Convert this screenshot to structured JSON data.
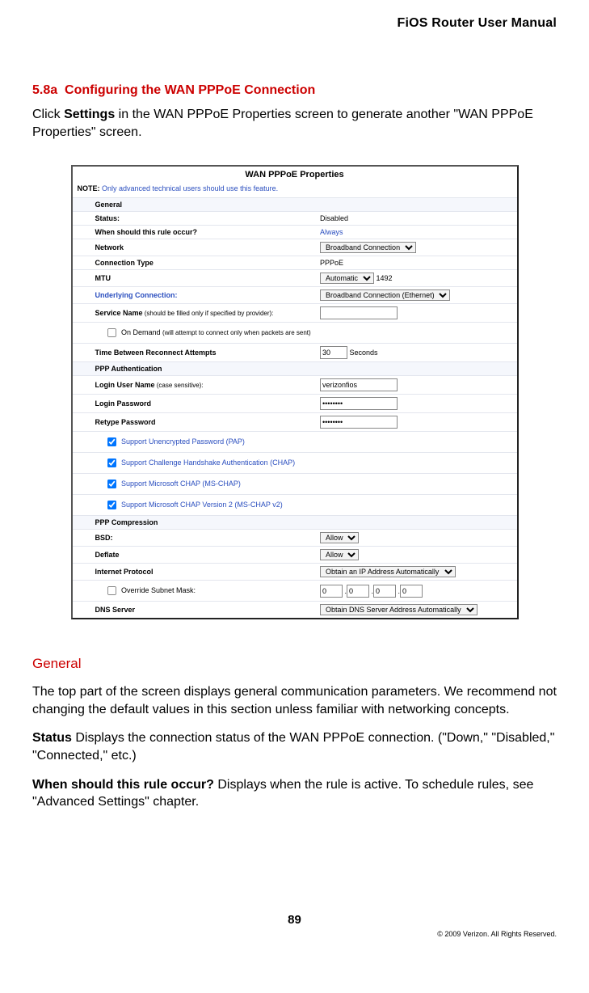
{
  "header": {
    "title": "FiOS Router User Manual"
  },
  "section": {
    "number": "5.8a",
    "title": "Configuring the WAN PPPoE Connection",
    "intro_prefix": "Click ",
    "intro_bold": "Settings",
    "intro_suffix": " in the WAN PPPoE Properties screen to generate another \"WAN PPPoE Properties\" screen."
  },
  "screenshot": {
    "title": "WAN PPPoE Properties",
    "note_label": "NOTE:",
    "note_text": " Only advanced technical users should use this feature.",
    "rows": {
      "general": "General",
      "status_l": "Status:",
      "status_v": "Disabled",
      "rule_l": "When should this rule occur?",
      "rule_v": "Always",
      "network_l": "Network",
      "network_v": "Broadband Connection",
      "conntype_l": "Connection Type",
      "conntype_v": "PPPoE",
      "mtu_l": "MTU",
      "mtu_sel": "Automatic",
      "mtu_num": "1492",
      "under_l": "Underlying Connection:",
      "under_v": "Broadband Connection (Ethernet)",
      "svcname_l": "Service Name",
      "svcname_sub": " (should be filled only if specified by provider):",
      "ondemand_l": " On Demand ",
      "ondemand_sub": "(will attempt to connect only when packets are sent)",
      "tbra_l": "Time Between Reconnect Attempts",
      "tbra_v": "30",
      "tbra_unit": "Seconds",
      "pppauth": "PPP Authentication",
      "login_l": "Login User Name",
      "login_sub": " (case sensitive):",
      "login_v": "verizonfios",
      "pwd_l": "Login Password",
      "pwd_v": "********",
      "rpwd_l": "Retype Password",
      "rpwd_v": "********",
      "pap": " Support Unencrypted Password (PAP)",
      "chap": " Support Challenge Handshake Authentication (CHAP)",
      "mschap": " Support Microsoft CHAP (MS-CHAP)",
      "mschap2": " Support Microsoft CHAP Version 2 (MS-CHAP v2)",
      "pppcomp": "PPP Compression",
      "bsd_l": "BSD:",
      "bsd_v": "Allow",
      "deflate_l": "Deflate",
      "deflate_v": "Allow",
      "ip_l": "Internet Protocol",
      "ip_v": "Obtain an IP Address Automatically",
      "subnet_l": " Override Subnet Mask:",
      "subnet_oct": "0",
      "dns_l": "DNS Server",
      "dns_v": "Obtain DNS Server Address Automatically"
    }
  },
  "general": {
    "heading": "General",
    "p1": "The top part of the screen displays general communication parameters. We recommend not changing the default values in this section unless familiar with networking concepts.",
    "status_label": "Status",
    "status_text": "  Displays the connection status of the WAN PPPoE connection. (\"Down,\" \"Disabled,\" \"Connected,\" etc.)",
    "rule_label": "When should this rule occur?",
    "rule_text": "  Displays when the rule is active. To schedule rules, see \"Advanced Settings\" chapter."
  },
  "footer": {
    "page": "89",
    "copyright": "© 2009 Verizon. All Rights Reserved."
  }
}
